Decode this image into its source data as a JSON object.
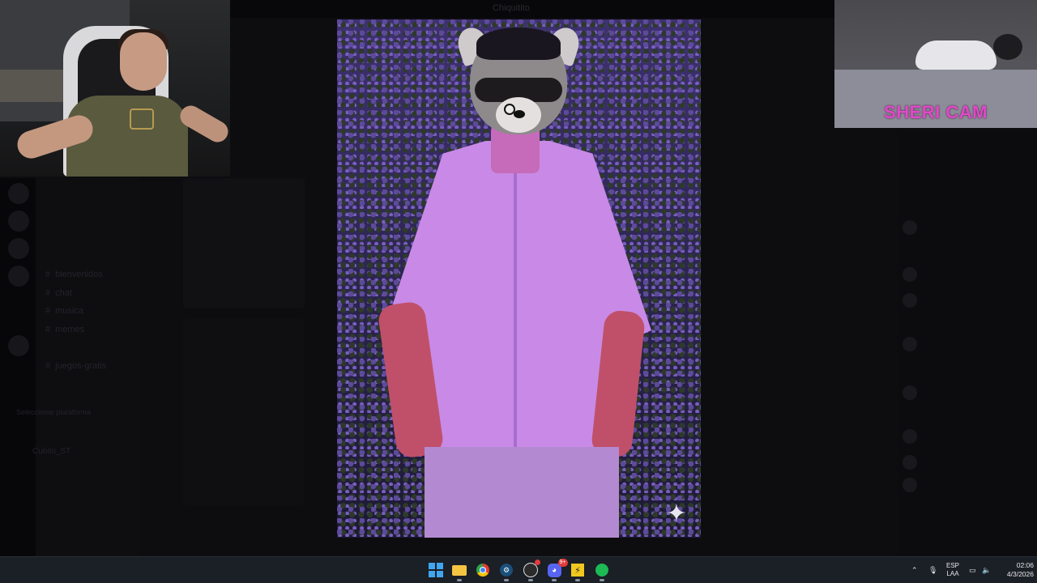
{
  "background_app": {
    "title": "Chiquitito",
    "channels": [
      {
        "label": "bienvenidos"
      },
      {
        "label": "chat"
      },
      {
        "label": "musica"
      },
      {
        "label": "memes"
      },
      {
        "label": "juegos-gratis"
      }
    ],
    "platform_label": "Seleccionar plataforma",
    "user_label": "Cubito_ST"
  },
  "overlays": {
    "cat_cam_label": "SHERI CAM"
  },
  "taskbar": {
    "apps": [
      "start",
      "file-explorer",
      "chrome",
      "steam",
      "obs",
      "discord",
      "winamp",
      "spotify"
    ],
    "discord_badge": "9+",
    "language_line1": "ESP",
    "language_line2": "LAA",
    "time": "02:06",
    "date": "4/3/2026"
  },
  "colors": {
    "cat_cam_label": "#e049c8",
    "taskbar_bg": "#1b1f26"
  }
}
